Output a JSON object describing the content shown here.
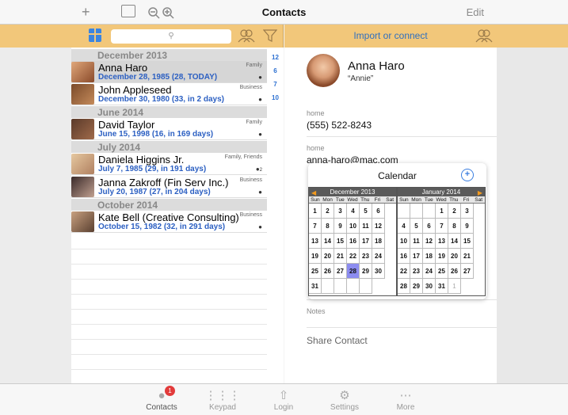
{
  "topbar": {
    "title": "Contacts",
    "edit_label": "Edit",
    "add_icon": "plus-icon",
    "book_icon": "book-icon",
    "zoom_out_icon": "zoom-out-icon",
    "zoom_in_icon": "zoom-in-icon"
  },
  "strip": {
    "import_label": "Import or connect"
  },
  "sections": [
    {
      "label": "December 2013"
    },
    {
      "label": "June 2014"
    },
    {
      "label": "July 2014"
    },
    {
      "label": "October 2014"
    }
  ],
  "contacts": [
    {
      "name": "Anna Haro",
      "date": "December 28, 1985 (28, TODAY)",
      "tag": "Family",
      "badge": ""
    },
    {
      "name": "John Appleseed",
      "date": "December 30, 1980 (33, in 2 days)",
      "tag": "Business",
      "badge": ""
    },
    {
      "name": "David Taylor",
      "date": "June 15, 1998 (16, in 169 days)",
      "tag": "Family",
      "badge": ""
    },
    {
      "name": "Daniela Higgins Jr.",
      "date": "July 7, 1985 (29, in 191 days)",
      "tag": "Family, Friends",
      "badge": "2"
    },
    {
      "name": "Janna Zakroff (Fin Serv Inc.)",
      "date": "July 20, 1987 (27, in 204 days)",
      "tag": "Business",
      "badge": ""
    },
    {
      "name": "Kate Bell (Creative Consulting)",
      "date": "October 15, 1982 (32, in 291 days)",
      "tag": "Business",
      "badge": ""
    }
  ],
  "index": [
    "12",
    "6",
    "7",
    "10"
  ],
  "detail": {
    "name": "Anna Haro",
    "nickname": "“Annie”",
    "phone_label": "home",
    "phone": "(555) 522-8243",
    "email_label": "home",
    "email": "anna-haro@mac.com",
    "notes_label": "Notes",
    "share_label": "Share Contact"
  },
  "calendar": {
    "title": "Calendar",
    "dow": [
      "Sun",
      "Mon",
      "Tue",
      "Wed",
      "Thu",
      "Fri",
      "Sat"
    ],
    "month1": {
      "name": "December 2013",
      "days": [
        "1",
        "2",
        "3",
        "4",
        "5",
        "6",
        "7",
        "8",
        "9",
        "10",
        "11",
        "12",
        "13",
        "14",
        "15",
        "16",
        "17",
        "18",
        "19",
        "20",
        "21",
        "22",
        "23",
        "24",
        "25",
        "26",
        "27",
        "28",
        "29",
        "30",
        "31",
        "",
        "",
        "",
        ""
      ],
      "highlight": "28"
    },
    "month2": {
      "name": "January 2014",
      "days": [
        "",
        "",
        "",
        "1",
        "2",
        "3",
        "4",
        "5",
        "6",
        "7",
        "8",
        "9",
        "10",
        "11",
        "12",
        "13",
        "14",
        "15",
        "16",
        "17",
        "18",
        "19",
        "20",
        "21",
        "22",
        "23",
        "24",
        "25",
        "26",
        "27",
        "28",
        "29",
        "30",
        "31",
        "1"
      ],
      "dim": [
        "1"
      ]
    }
  },
  "bottom": [
    {
      "label": "Contacts",
      "icon": "person-icon",
      "badge": "1"
    },
    {
      "label": "Keypad",
      "icon": "keypad-icon"
    },
    {
      "label": "Login",
      "icon": "login-icon"
    },
    {
      "label": "Settings",
      "icon": "gear-icon"
    },
    {
      "label": "More",
      "icon": "more-icon"
    }
  ]
}
